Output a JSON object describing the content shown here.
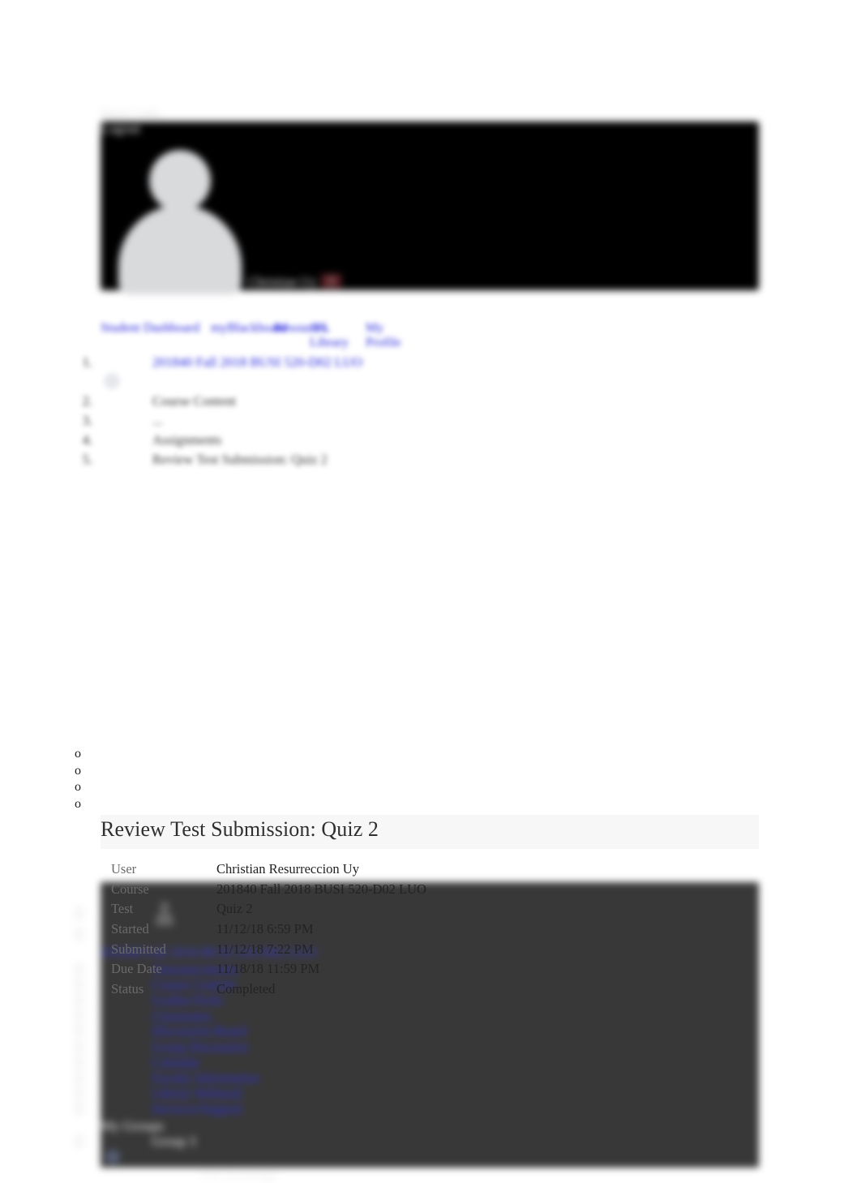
{
  "header": {
    "quick_links_label": "Quick Links",
    "logout_label": "Logout",
    "user_name": "Christian Uy",
    "badge_count": "2",
    "avatar_icon": "user-avatar-icon",
    "background_color": "#000000"
  },
  "top_nav": {
    "items": [
      {
        "label": "Student Dashboard"
      },
      {
        "label": "myBlackboard"
      },
      {
        "label": "Resources"
      },
      {
        "label": "JFL Library"
      },
      {
        "label": "My Profile"
      }
    ],
    "link_color": "#2222dd"
  },
  "breadcrumb": {
    "items": [
      {
        "number": "1.",
        "label": "201840 Fall 2018 BUSI 520-D02 LUO",
        "is_link": true
      },
      {
        "number": "2.",
        "label": "Course Content",
        "is_link": false
      },
      {
        "number": "3.",
        "label": "...",
        "is_link": false
      },
      {
        "number": "4.",
        "label": "Assignments",
        "is_link": false
      },
      {
        "number": "5.",
        "label": "Review Test Submission: Quiz 2",
        "is_link": false
      }
    ]
  },
  "course_menu": {
    "panel_color": "#383838",
    "course_title": "201840 Fall 2018 BUSI 520-D02 LUO",
    "links": [
      {
        "label": "Announcements"
      },
      {
        "label": "Course Content"
      },
      {
        "label": "Grades/Tools"
      },
      {
        "label": "Classmates"
      },
      {
        "label": "Discussion Board"
      },
      {
        "label": "Group Discussion"
      },
      {
        "label": "Calendar"
      },
      {
        "label": "Faculty Information"
      },
      {
        "label": "Liberty Webmail"
      },
      {
        "label": "Services/Support"
      }
    ],
    "groups_heading": "My Groups",
    "group_name": "Group 3",
    "file_exchange_label": "File Exchange",
    "link_color": "#2d2de2"
  },
  "sub_bullets": {
    "markers": [
      "o",
      "o",
      "o",
      "o"
    ]
  },
  "main": {
    "heading": "Review Test Submission: Quiz 2",
    "details": [
      {
        "label": "User",
        "value": "Christian Resurreccion Uy"
      },
      {
        "label": "Course",
        "value": "201840 Fall 2018 BUSI 520-D02 LUO"
      },
      {
        "label": "Test",
        "value": "Quiz 2"
      },
      {
        "label": "Started",
        "value": "11/12/18 6:59 PM"
      },
      {
        "label": "Submitted",
        "value": "11/12/18 7:22 PM"
      },
      {
        "label": "Due Date",
        "value": "11/18/18 11:59 PM"
      },
      {
        "label": "Status",
        "value": "Completed"
      }
    ]
  }
}
